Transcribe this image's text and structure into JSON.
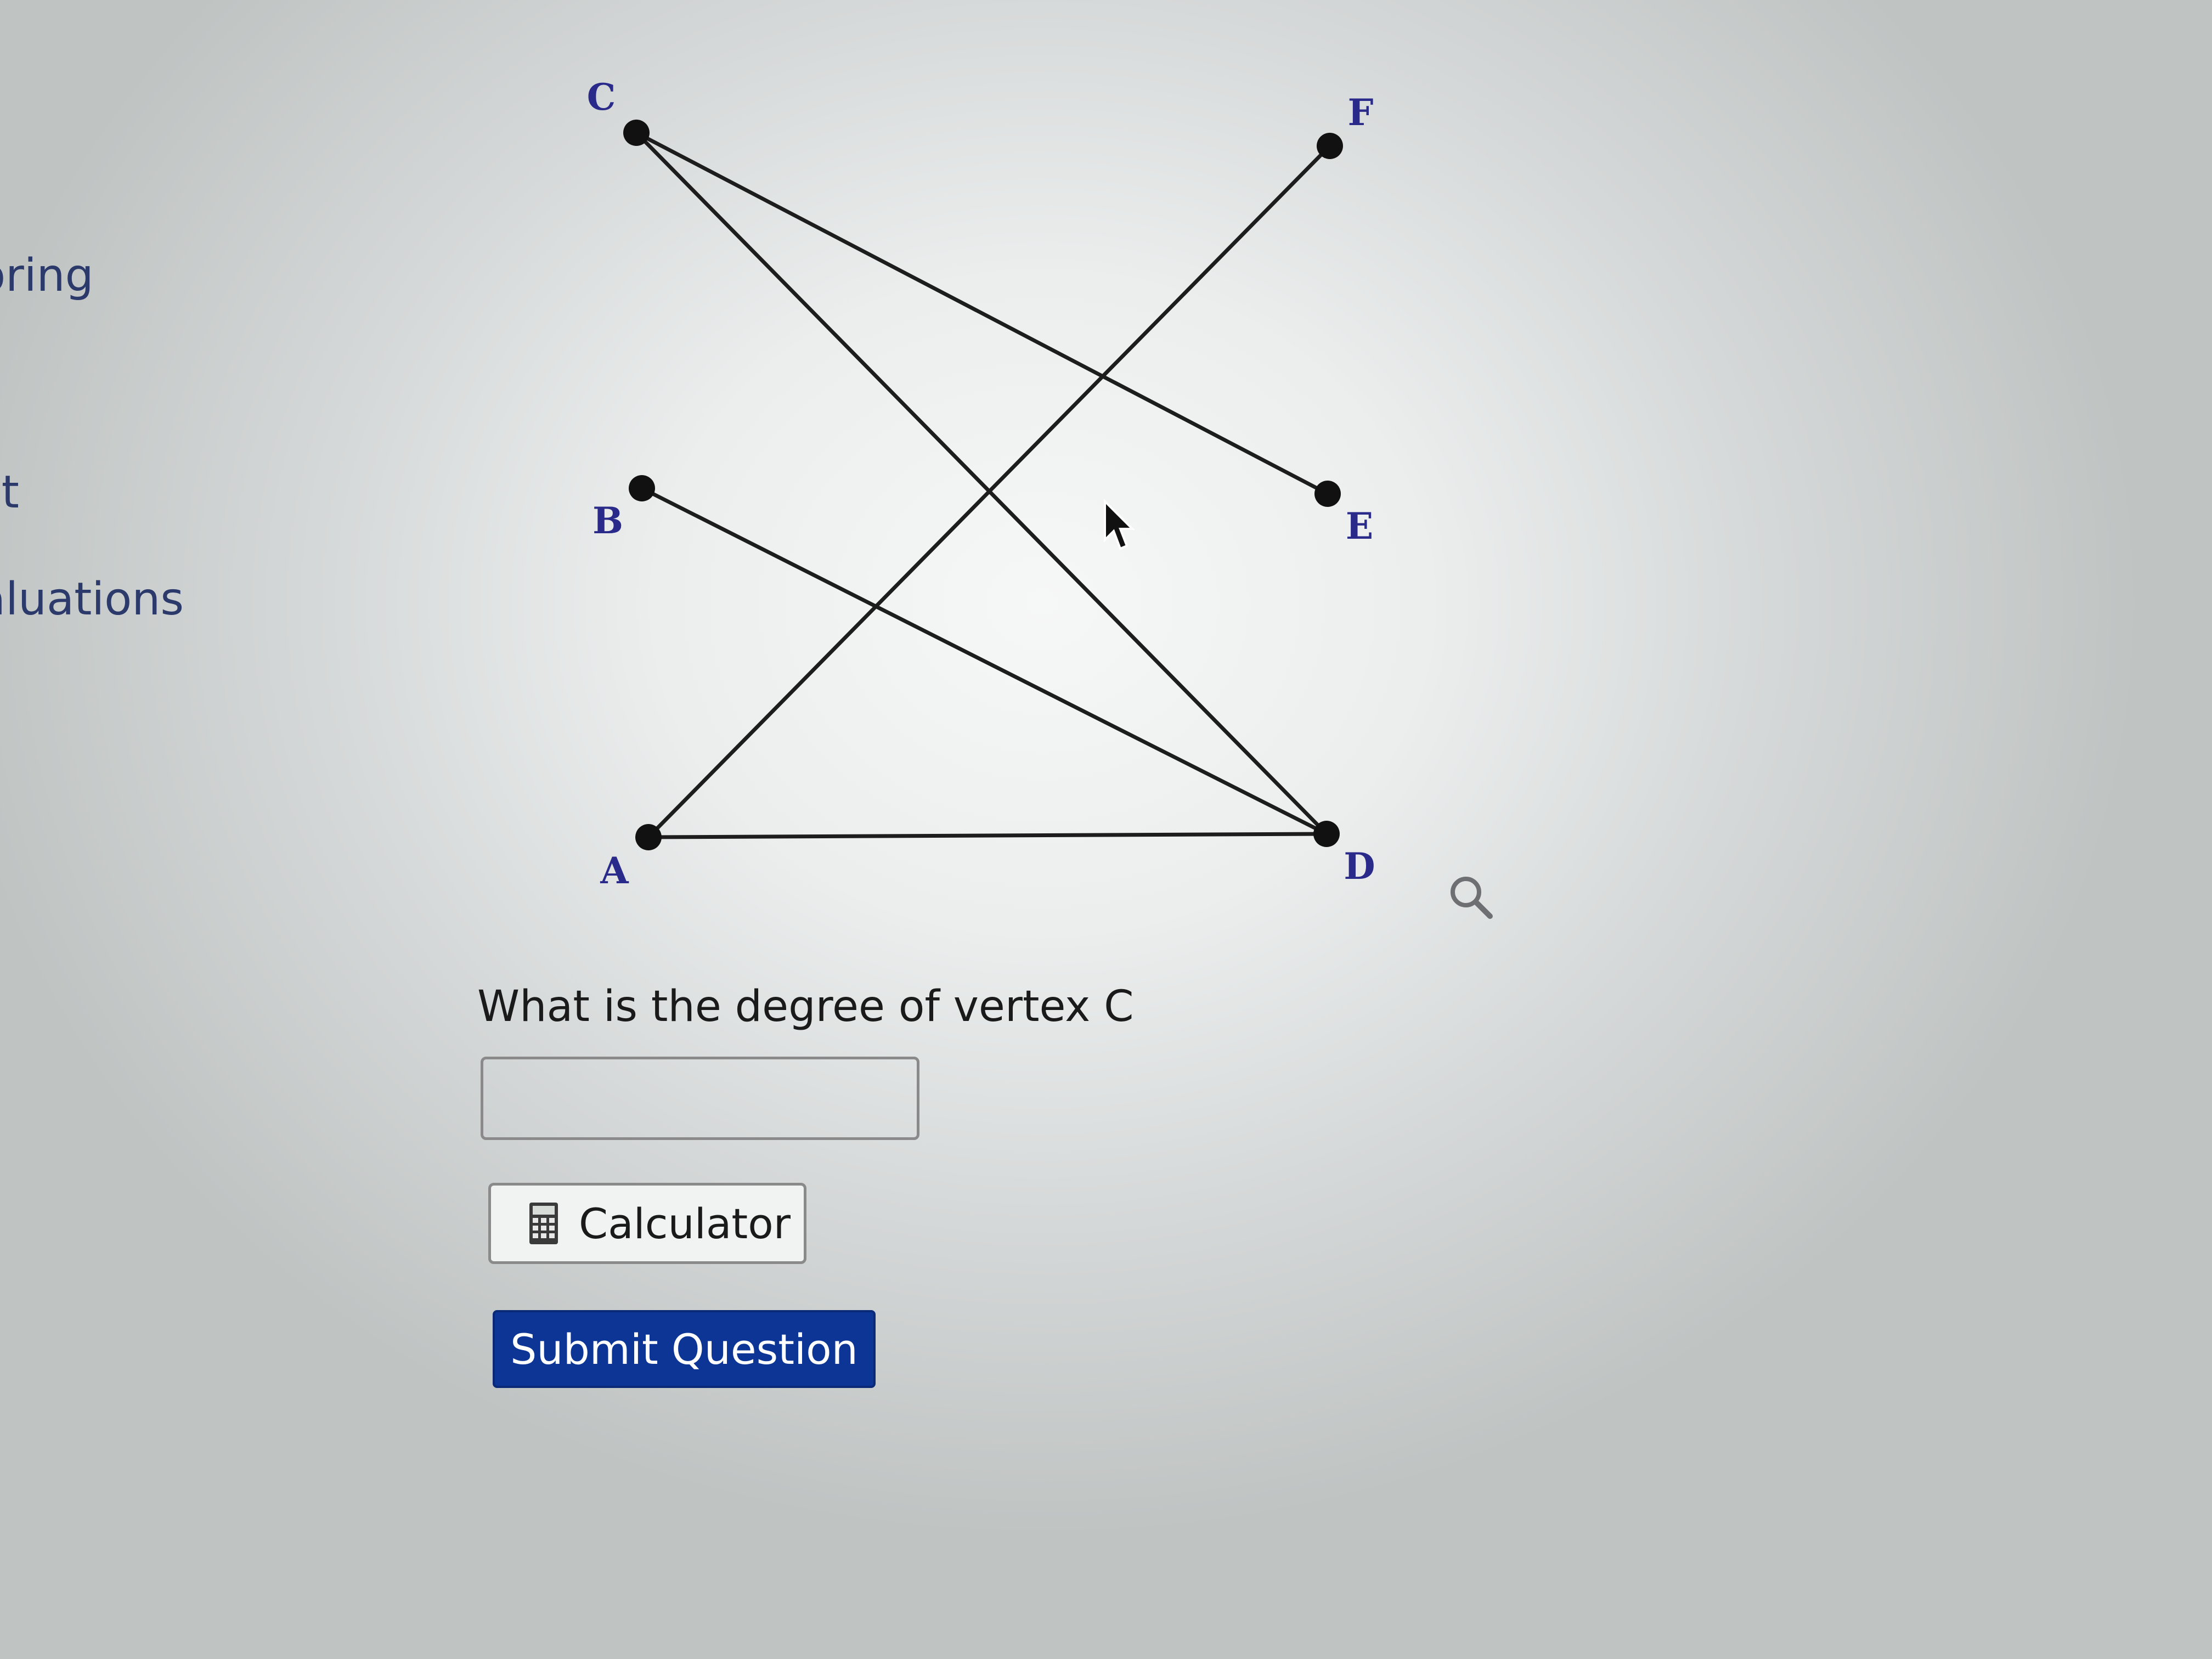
{
  "sidebar": {
    "items": [
      {
        "label": "oring"
      },
      {
        "label": "st"
      },
      {
        "label": "aluations"
      }
    ]
  },
  "graph": {
    "vertices": [
      {
        "id": "C",
        "label": "C"
      },
      {
        "id": "F",
        "label": "F"
      },
      {
        "id": "B",
        "label": "B"
      },
      {
        "id": "E",
        "label": "E"
      },
      {
        "id": "A",
        "label": "A"
      },
      {
        "id": "D",
        "label": "D"
      }
    ],
    "edges": [
      [
        "C",
        "E"
      ],
      [
        "C",
        "D"
      ],
      [
        "F",
        "A"
      ],
      [
        "B",
        "D"
      ],
      [
        "A",
        "D"
      ]
    ]
  },
  "question": {
    "text": "What is the degree of vertex C",
    "answer_value": ""
  },
  "buttons": {
    "calculator_label": "Calculator",
    "submit_label": "Submit Question"
  },
  "icons": {
    "calculator": "calculator-icon",
    "magnify": "magnifier-icon",
    "cursor": "mouse-pointer-icon"
  },
  "colors": {
    "submit_bg": "#0c3596",
    "vertex_label": "#2a2a8a",
    "sidebar_text": "#2b3a6b"
  }
}
